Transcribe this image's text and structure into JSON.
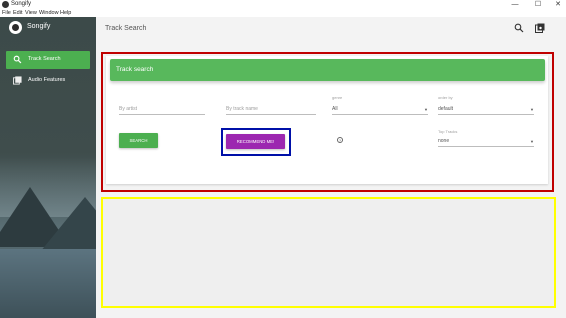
{
  "window": {
    "title": "Songify",
    "controls": {
      "minimize": "—",
      "maximize": "☐",
      "close": "✕"
    }
  },
  "menu": {
    "items": [
      "File",
      "Edit",
      "View",
      "Window",
      "Help"
    ]
  },
  "sidebar": {
    "brand": "Songify",
    "items": [
      {
        "label": "Track Search",
        "icon": "search-icon",
        "active": true
      },
      {
        "label": "Audio Features",
        "icon": "library-icon",
        "active": false
      }
    ]
  },
  "header": {
    "title": "Track Search",
    "icons": [
      "search-icon",
      "library-music-icon"
    ]
  },
  "search_card": {
    "title": "Track search",
    "artist_placeholder": "By artist",
    "track_placeholder": "By track name",
    "genre_label": "genre",
    "genre_value": "All",
    "order_label": "order by",
    "order_value": "default",
    "search_button": "SEARCH",
    "recommend_button": "RECOMMEND ME!",
    "help_icon_glyph": "?",
    "top_tracks_label": "Top Tracks",
    "top_tracks_value": "none"
  },
  "colors": {
    "accent_green": "#4caf50",
    "recommend_purple": "#9c27b0",
    "highlight_red": "#c00000",
    "highlight_blue": "#0010a8",
    "highlight_yellow": "#ffff00"
  }
}
